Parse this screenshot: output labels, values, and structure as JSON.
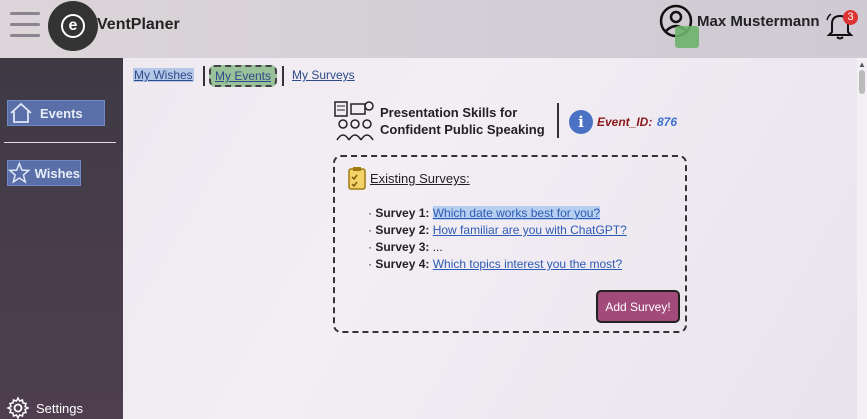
{
  "app": {
    "name": "VentPlaner",
    "logo_letter": "e"
  },
  "user": {
    "name": "Max Mustermann"
  },
  "notifications": {
    "count": "3"
  },
  "sidebar": {
    "items": [
      {
        "label": "Events",
        "icon": "home-icon"
      },
      {
        "label": "Wishes",
        "icon": "star-icon"
      }
    ],
    "settings_label": "Settings"
  },
  "tabs": [
    {
      "label": "My Wishes"
    },
    {
      "label": "My Events"
    },
    {
      "label": "My Surveys"
    }
  ],
  "event": {
    "title_line1": "Presentation Skills for",
    "title_line2": "Confident Public Speaking",
    "id_label": "Event_ID:",
    "id_value": "876"
  },
  "surveys": {
    "title": "Existing Surveys:",
    "items": [
      {
        "label": "Survey 1:",
        "question": "Which date works best for you?"
      },
      {
        "label": "Survey 2:",
        "question": "How familiar are you with ChatGPT?"
      },
      {
        "label": "Survey 3:",
        "question": "..."
      },
      {
        "label": "Survey 4:",
        "question": "Which topics interest you the most?"
      }
    ],
    "add_button": "Add Survey!"
  },
  "colors": {
    "nav_active": "#5a6fa8",
    "tab_active": "#9ac29a",
    "add_button": "#a24a7a",
    "event_id_label": "#8a1a1a",
    "event_id_value": "#3a6fd0",
    "badge": "#dd3333"
  }
}
